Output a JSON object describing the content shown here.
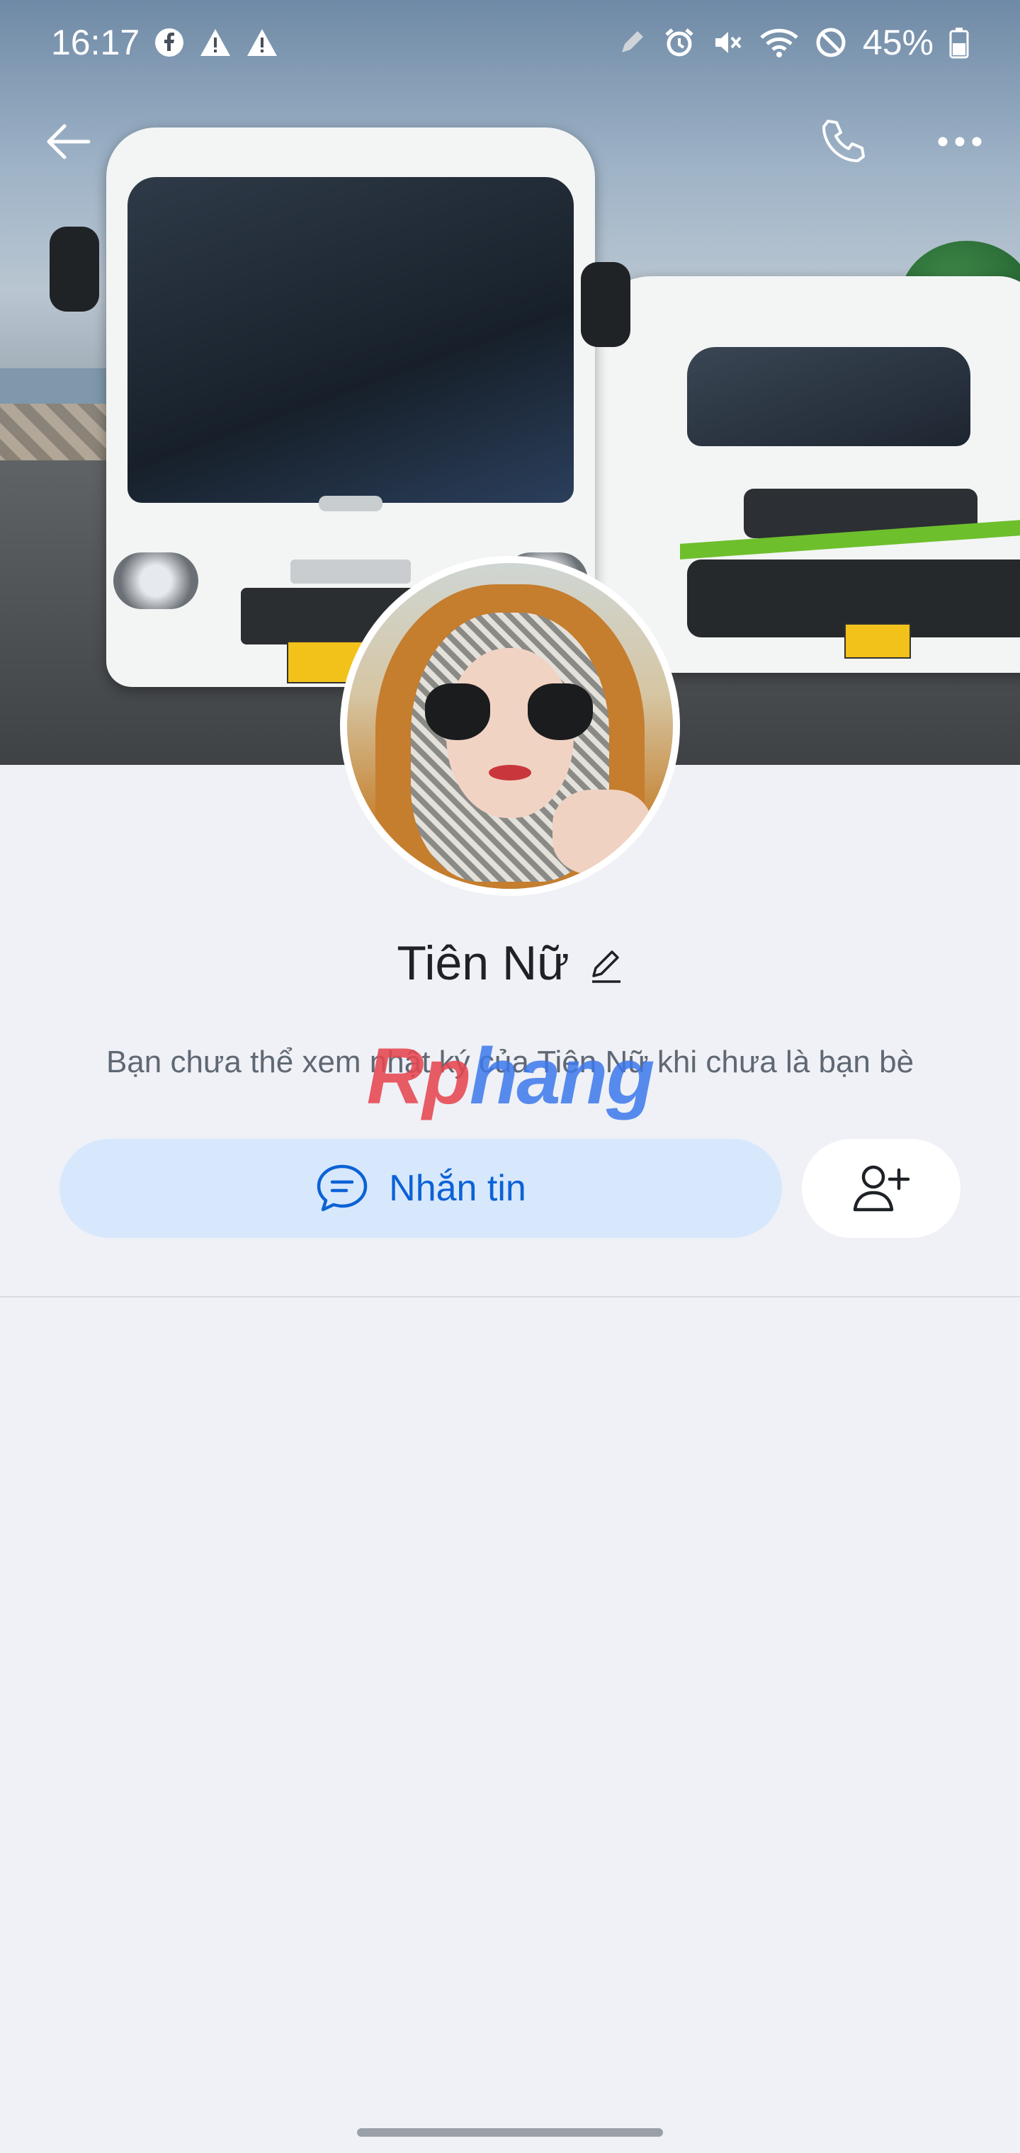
{
  "status_bar": {
    "time": "16:17",
    "battery": "45%",
    "icons": [
      "facebook-icon",
      "warning-icon",
      "warning-icon",
      "pen-icon",
      "alarm-icon",
      "mute-icon",
      "wifi-icon",
      "dnd-icon",
      "battery-icon"
    ]
  },
  "profile": {
    "name": "Tiên Nữ",
    "privacy_note": "Bạn chưa thể xem nhật ký của Tiên Nữ khi chưa là bạn bè"
  },
  "actions": {
    "message_label": "Nhắn tin"
  },
  "watermark": {
    "part1": "Rp",
    "part2": "hang"
  },
  "colors": {
    "background": "#eff1f6",
    "primary_blue": "#0c62d6",
    "message_button_bg": "#d7e8fd"
  }
}
